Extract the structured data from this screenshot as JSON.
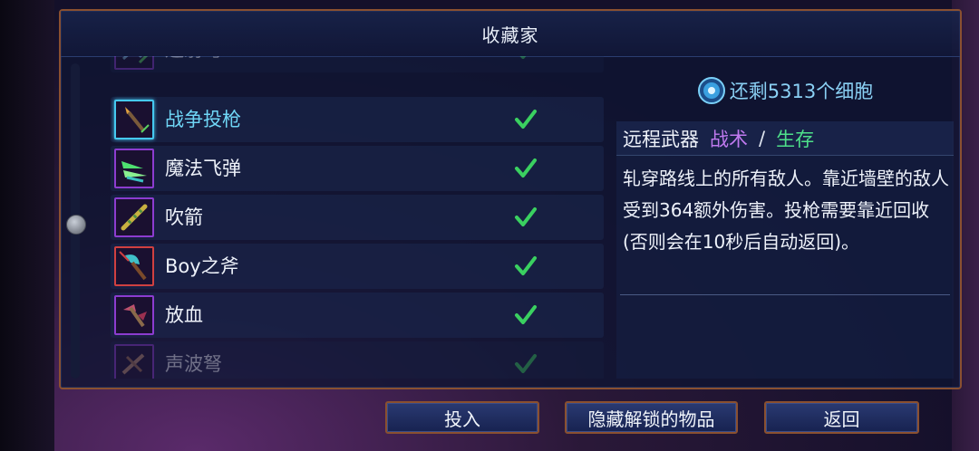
{
  "title": "收藏家",
  "cells": {
    "text": "还剩5313个细胞",
    "icon": "blue-cell-icon"
  },
  "items": [
    {
      "name": "连射弩",
      "icon": "repeater-crossbow-icon",
      "state": "faded"
    },
    {
      "name": "战争投枪",
      "icon": "war-javelin-icon",
      "state": "selected"
    },
    {
      "name": "魔法飞弹",
      "icon": "magic-missiles-icon",
      "state": "normal"
    },
    {
      "name": "吹箭",
      "icon": "blowgun-icon",
      "state": "normal"
    },
    {
      "name": "Boy之斧",
      "icon": "boy-axe-icon",
      "state": "normal"
    },
    {
      "name": "放血",
      "icon": "bloodletting-icon",
      "state": "normal"
    },
    {
      "name": "声波弩",
      "icon": "sonic-crossbow-icon",
      "state": "faded"
    }
  ],
  "detail": {
    "category": "远程武器",
    "tag_tactics": "战术",
    "separator": "/",
    "tag_survival": "生存",
    "description": "轧穿路线上的所有敌人。靠近墙壁的敌人受到364额外伤害。投枪需要靠近回收(否则会在10秒后自动返回)。"
  },
  "buttons": {
    "invest": "投入",
    "hide_unlocked": "隐藏解锁的物品",
    "back": "返回"
  },
  "colors": {
    "panel_border": "#8a5030",
    "tactics": "#c07af0",
    "survival": "#4ee08a",
    "check": "#3ad060",
    "selected_text": "#6fd6f6"
  }
}
